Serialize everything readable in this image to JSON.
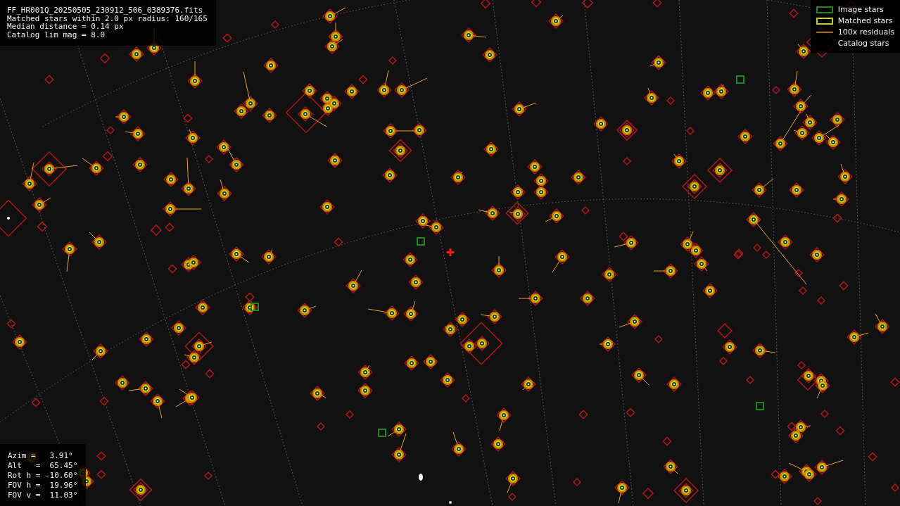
{
  "info_lines": [
    "FF_HR001Q_20250505_230912_506_0389376.fits",
    "Matched stars within 2.0 px radius: 160/165",
    "Median distance = 0.14 px",
    "Catalog lim mag = 8.0"
  ],
  "legend": [
    {
      "kind": "image",
      "label": "Image stars"
    },
    {
      "kind": "matched",
      "label": "Matched stars"
    },
    {
      "kind": "residual",
      "label": "100x residuals"
    },
    {
      "kind": "catalog",
      "label": "Catalog stars"
    }
  ],
  "pointing_lines": [
    "Azim =   3.91°",
    "Alt   =  65.45°",
    "Rot h = -10.60°",
    "FOV h =  19.96°",
    "FOV v =  11.03°"
  ]
}
